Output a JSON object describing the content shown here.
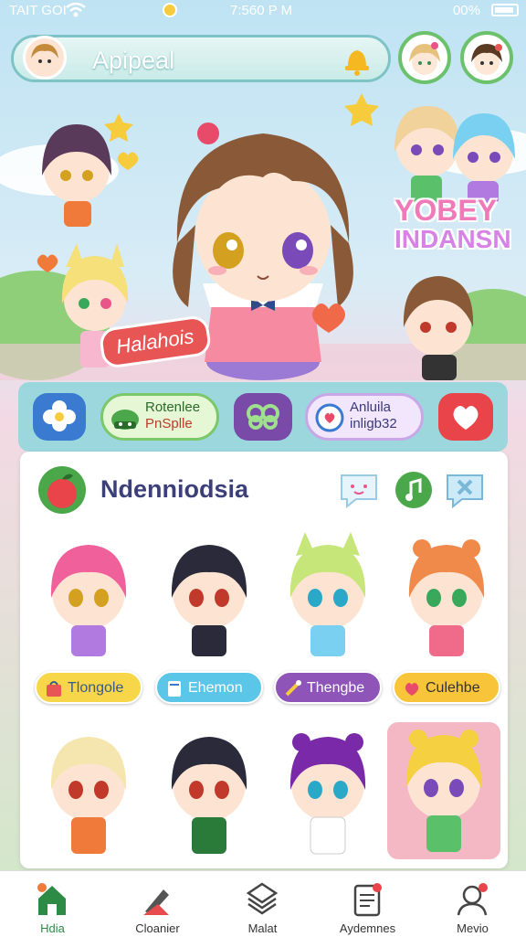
{
  "status_bar": {
    "carrier": "TAIT GOI",
    "time": "7:560 P M",
    "battery": "00%"
  },
  "header": {
    "title": "Apipeal"
  },
  "hero": {
    "tag": "Halahois",
    "logo_line1": "YOBEY",
    "logo_line2": "INDANSN"
  },
  "quick_actions": [
    {
      "icon": "flower-icon"
    },
    {
      "label_line1": "Rotenlee",
      "label_line2": "PnSplle",
      "icon": "bowl-icon"
    },
    {
      "icon": "link-icon"
    },
    {
      "label_line1": "Anluila",
      "label_line2": "inligb32",
      "icon": "heart-chat-icon"
    },
    {
      "icon": "heart-icon"
    }
  ],
  "main": {
    "title": "Ndenniodsia",
    "characters_row1": [
      {
        "label": "Tlongole",
        "color": "#f7d64a",
        "text_color": "#3a5a8a"
      },
      {
        "label": "Ehemon",
        "color": "#5cc6e8",
        "text_color": "#ffffff"
      },
      {
        "label": "Thengbe",
        "color": "#8e54b8",
        "text_color": "#ffffff"
      },
      {
        "label": "Culehbe",
        "color": "#f7c43a",
        "text_color": "#333333"
      }
    ]
  },
  "nav": [
    {
      "label": "Hdia",
      "icon": "home-icon",
      "active": true
    },
    {
      "label": "Cloanier",
      "icon": "pencil-icon"
    },
    {
      "label": "Malat",
      "icon": "layers-icon"
    },
    {
      "label": "Aydemnes",
      "icon": "notepad-icon"
    },
    {
      "label": "Mevio",
      "icon": "profile-icon"
    }
  ],
  "colors": {
    "accent": "#7ec4c6",
    "active_nav": "#2d8b46",
    "title": "#3b3f7a"
  }
}
